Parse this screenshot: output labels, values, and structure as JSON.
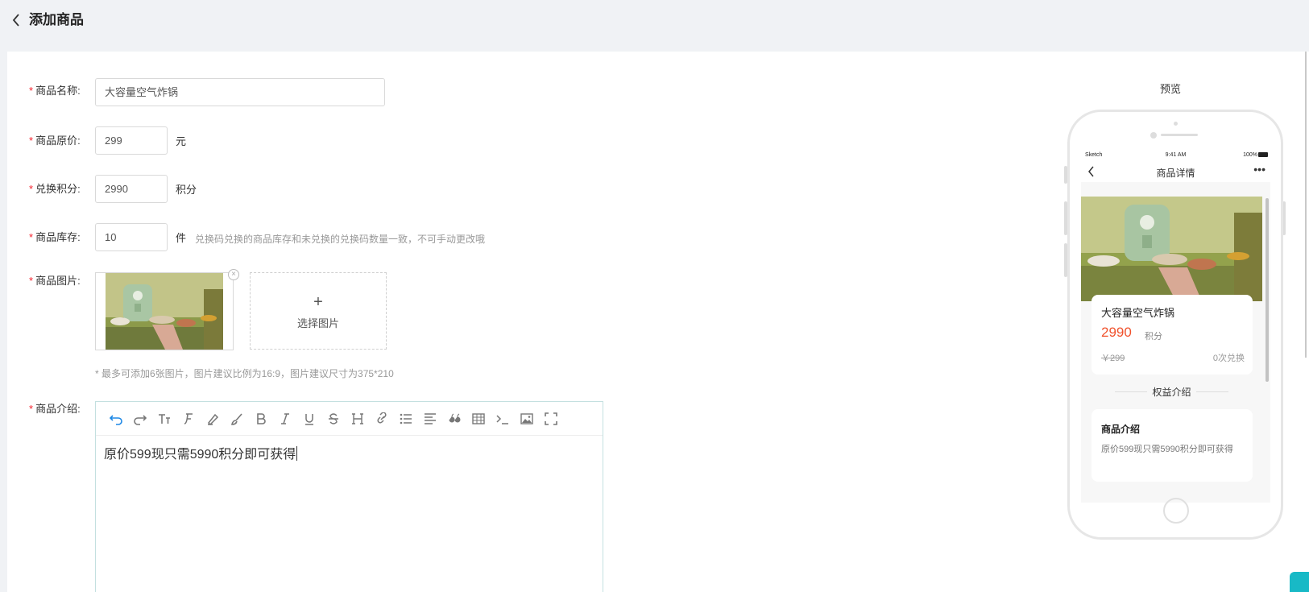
{
  "header": {
    "back_icon": "chevron-left-icon",
    "title": "添加商品"
  },
  "form": {
    "name": {
      "label": "商品名称:",
      "value": "大容量空气炸锅"
    },
    "price": {
      "label": "商品原价:",
      "value": "299",
      "unit": "元"
    },
    "points": {
      "label": "兑换积分:",
      "value": "2990",
      "unit": "积分"
    },
    "stock": {
      "label": "商品库存:",
      "value": "10",
      "unit": "件",
      "hint": "兑换码兑换的商品库存和未兑换的兑换码数量一致，不可手动更改哦"
    },
    "images": {
      "label": "商品图片:",
      "add_label": "选择图片",
      "hint": "* 最多可添加6张图片，图片建议比例为16:9，图片建议尺寸为375*210"
    },
    "intro": {
      "label": "商品介绍:",
      "content": "原价599现只需5990积分即可获得"
    },
    "required_mark": "*"
  },
  "editor_toolbar": [
    "undo-icon",
    "redo-icon",
    "font-size-icon",
    "font-family-icon",
    "highlighter-icon",
    "brush-icon",
    "bold-icon",
    "italic-icon",
    "underline-icon",
    "strikethrough-icon",
    "heading-icon",
    "link-icon",
    "list-icon",
    "align-icon",
    "quote-icon",
    "table-icon",
    "code-icon",
    "image-icon",
    "fullscreen-icon"
  ],
  "preview": {
    "label": "预览",
    "status": {
      "carrier": "Sketch",
      "time": "9:41 AM",
      "battery": "100%"
    },
    "nav_title": "商品详情",
    "product": {
      "name": "大容量空气炸锅",
      "points": "2990",
      "points_unit": "积分",
      "orig_price": "￥299",
      "redeem_count": "0次兑换"
    },
    "section_title": "权益介绍",
    "intro_title": "商品介绍",
    "intro_text": "原价599现只需5990积分即可获得"
  },
  "colors": {
    "accent": "#18b9c6",
    "required": "#f5222d",
    "price": "#f0522d"
  }
}
